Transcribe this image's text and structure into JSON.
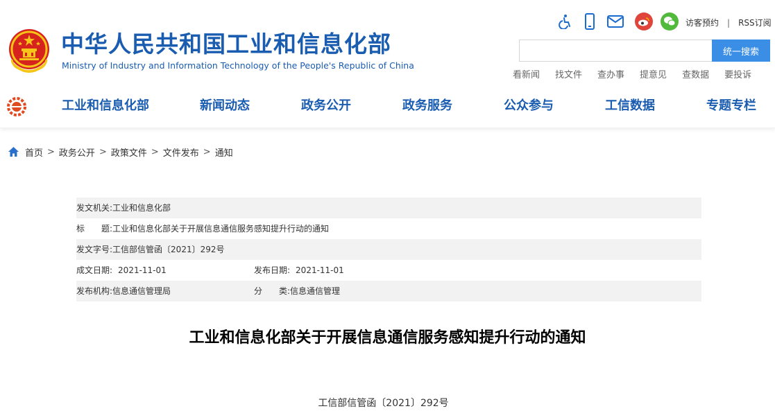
{
  "header": {
    "title_cn": "中华人民共和国工业和信息化部",
    "title_en": "Ministry of Industry and Information Technology of the People's Republic of China",
    "icons": [
      "accessibility-icon",
      "mobile-icon",
      "mail-icon",
      "weibo-icon",
      "wechat-icon"
    ],
    "visitor_label": "访客预约",
    "rss_label": "RSS订阅",
    "search_placeholder": "",
    "search_button": "统一搜索",
    "quick_links": [
      "看新闻",
      "找文件",
      "查办事",
      "提意见",
      "查数据",
      "要投诉"
    ]
  },
  "nav": {
    "items": [
      "工业和信息化部",
      "新闻动态",
      "政务公开",
      "政务服务",
      "公众参与",
      "工信数据",
      "专题专栏"
    ]
  },
  "breadcrumb": [
    "首页",
    "政务公开",
    "政策文件",
    "文件发布",
    "通知"
  ],
  "info": {
    "issuer_label": "发文机关:",
    "issuer": "工业和信息化部",
    "title_label": "标　　题:",
    "title": "工业和信息化部关于开展信息通信服务感知提升行动的通知",
    "doc_no_label": "发文字号:",
    "doc_no": "工信部信管函〔2021〕292号",
    "created_label": "成文日期:",
    "created": "2021-11-01",
    "published_label": "发布日期:",
    "published": "2021-11-01",
    "org_label": "发布机构:",
    "org": "信息通信管理局",
    "category_label": "分　　类:",
    "category": "信息通信管理"
  },
  "article": {
    "title": "工业和信息化部关于开展信息通信服务感知提升行动的通知",
    "doc_no": "工信部信管函〔2021〕292号"
  },
  "colors": {
    "brand_blue": "#1a5cb0",
    "search_button": "#3a8ee6",
    "weibo_red": "#e0453b",
    "wechat_green": "#51b93b",
    "row_shade": "#f2f2f2"
  }
}
